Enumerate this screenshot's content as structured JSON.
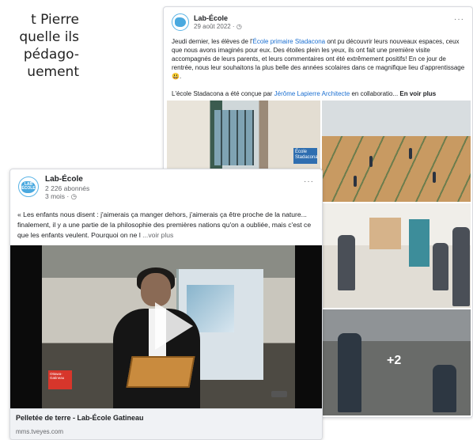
{
  "background_text": {
    "lines": [
      "t Pierre",
      "quelle ils",
      "pédago-",
      "uement"
    ]
  },
  "post_back": {
    "page_name": "Lab-École",
    "date": "29 août 2022 · ",
    "body_pre": "Jeudi dernier, les élèves de l'",
    "body_link": "École primaire Stadacona",
    "body_post": " ont pu découvrir leurs nouveaux espaces, ceux que nous avons imaginés pour eux. Des étoiles plein les yeux, ils ont fait une première visite accompagnés de leurs parents, et leurs commentaires ont été extrêmement positifs! En ce jour de rentrée, nous leur souhaitons la plus belle des années scolaires dans ce magnifique lieu d'apprentissage 😃.",
    "credit_pre": "L'école Stadacona a été conçue par ",
    "credit_link": "Jérôme Lapierre Architecte",
    "credit_post": " en collaboratio... ",
    "see_more": "En voir plus",
    "photo_sign": "École Stadacona",
    "more_photos": "+2"
  },
  "post_front": {
    "page_name": "Lab-École",
    "followers": "2 226 abonnés",
    "time": "3 mois · ",
    "avatar_text": "LAB ÉCOLE",
    "body": "« Les enfants nous disent : j'aimerais ça manger dehors, j'aimerais ça être proche de la nature... finalement, il y a une partie de la philosophie des premières nations qu'on a oubliée, mais c'est ce que les enfants veulent. Pourquoi on ne l",
    "see_more": "...voir plus",
    "video_logo": "Ottawa-Gatineau",
    "link_title": "Pelletée de terre - Lab-École Gatineau",
    "link_domain": "mms.tveyes.com"
  },
  "icons": {
    "more": "more-options-icon",
    "globe": "globe-icon",
    "play": "play-icon"
  },
  "colors": {
    "link": "#1b6fd1",
    "brand": "#4aa9df"
  }
}
